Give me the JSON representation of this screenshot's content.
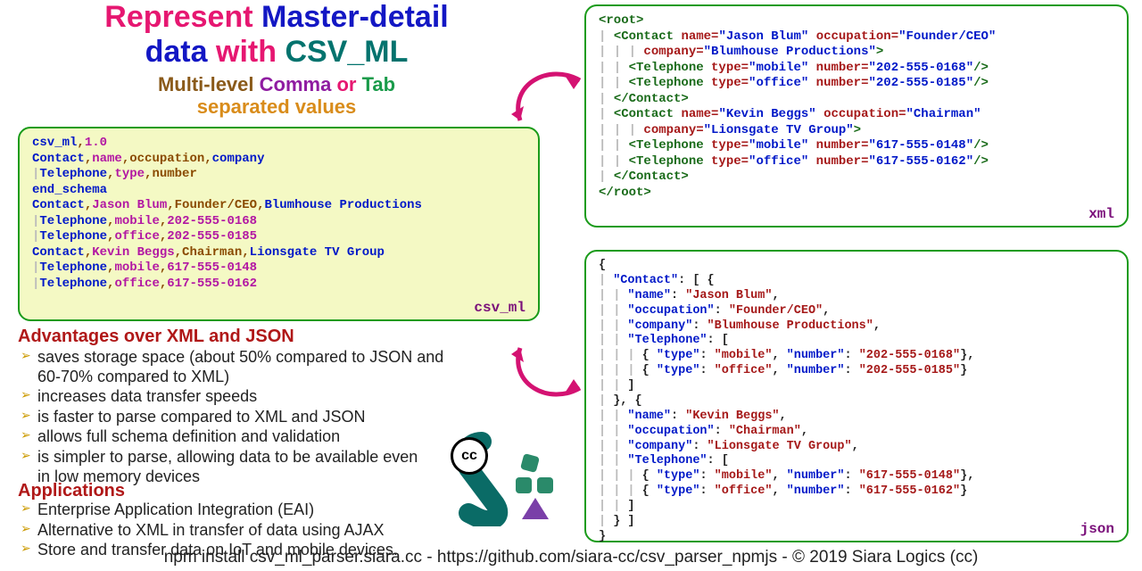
{
  "title": {
    "w1": "Represent",
    "w2": "Master-detail",
    "w3": "data",
    "w4": "with",
    "w5": "CSV_ML"
  },
  "subtitle": {
    "w1": "Multi-level",
    "w2": "Comma",
    "w3": "or",
    "w4": "Tab",
    "w5": "separated values"
  },
  "csvml": {
    "l1a": "csv_ml",
    "l1b": ",",
    "l1c": "1.0",
    "l2a": "Contact",
    "l2b": ",",
    "l2c": "name",
    "l2d": ",",
    "l2e": "occupation",
    "l2f": ",",
    "l2g": "company",
    "l3p": " |",
    "l3a": "Telephone",
    "l3b": ",",
    "l3c": "type",
    "l3d": ",",
    "l3e": "number",
    "l4": "end_schema",
    "l5a": "Contact",
    "l5b": ",",
    "l5c": "Jason Blum",
    "l5d": ",",
    "l5e": "Founder/CEO",
    "l5f": ",",
    "l5g": "Blumhouse Productions",
    "l6p": " |",
    "l6a": "Telephone",
    "l6b": ",",
    "l6c": "mobile",
    "l6d": ",",
    "l6e": "202-555-0168",
    "l7p": " |",
    "l7a": "Telephone",
    "l7b": ",",
    "l7c": "office",
    "l7d": ",",
    "l7e": "202-555-0185",
    "l8a": "Contact",
    "l8b": ",",
    "l8c": "Kevin Beggs",
    "l8d": ",",
    "l8e": "Chairman",
    "l8f": ",",
    "l8g": "Lionsgate TV Group",
    "l9p": " |",
    "l9a": "Telephone",
    "l9b": ",",
    "l9c": "mobile",
    "l9d": ",",
    "l9e": "617-555-0148",
    "l10p": " |",
    "l10a": "Telephone",
    "l10b": ",",
    "l10c": "office",
    "l10d": ",",
    "l10e": "617-555-0162",
    "label": "csv_ml"
  },
  "xml": {
    "label": "xml",
    "root_open": "<root>",
    "root_close": "</root>",
    "c1_open_a": "<Contact ",
    "c1_name_k": "name=",
    "c1_name_v": "\"Jason Blum\"",
    "sp": " ",
    "c1_occ_k": "occupation=",
    "c1_occ_v": "\"Founder/CEO\"",
    "c1_co_k": "company=",
    "c1_co_v": "\"Blumhouse Productions\"",
    "gt": ">",
    "t_open": "<Telephone ",
    "type_k": "type=",
    "num_k": "number=",
    "slashgt": "/>",
    "t1_type": "\"mobile\"",
    "t1_num": "\"202-555-0168\"",
    "t2_type": "\"office\"",
    "t2_num": "\"202-555-0185\"",
    "c_close": "</Contact>",
    "c2_name_v": "\"Kevin Beggs\"",
    "c2_occ_v": "\"Chairman\"",
    "c2_co_v": "\"Lionsgate TV Group\"",
    "t3_type": "\"mobile\"",
    "t3_num": "\"617-555-0148\"",
    "t4_type": "\"office\"",
    "t4_num": "\"617-555-0162\""
  },
  "json": {
    "label": "json",
    "brace_o": "{",
    "brace_c": "}",
    "brack_o": "[",
    "brack_c": "]",
    "contact_k": "\"Contact\"",
    "name_k": "\"name\"",
    "occ_k": "\"occupation\"",
    "co_k": "\"company\"",
    "tel_k": "\"Telephone\"",
    "type_k": "\"type\"",
    "num_k": "\"number\"",
    "c1_name": "\"Jason Blum\"",
    "c1_occ": "\"Founder/CEO\"",
    "c1_co": "\"Blumhouse Productions\"",
    "t1_type": "\"mobile\"",
    "t1_num": "\"202-555-0168\"",
    "t2_type": "\"office\"",
    "t2_num": "\"202-555-0185\"",
    "c2_name": "\"Kevin Beggs\"",
    "c2_occ": "\"Chairman\"",
    "c2_co": "\"Lionsgate TV Group\"",
    "t3_type": "\"mobile\"",
    "t3_num": "\"617-555-0148\"",
    "t4_type": "\"office\"",
    "t4_num": "\"617-555-0162\"",
    "colon": ": ",
    "comma": ",",
    "commaBrace": "}, {"
  },
  "advantages": {
    "heading": "Advantages over XML and JSON",
    "items": [
      "saves storage space (about 50% compared to JSON and 60-70% compared to XML)",
      "increases data transfer speeds",
      "is faster to parse compared to XML and JSON",
      "allows full schema definition and validation",
      "is simpler to parse, allowing data to be available even in low memory devices"
    ]
  },
  "apps": {
    "heading": "Applications",
    "items": [
      "Enterprise Application Integration (EAI)",
      "Alternative to XML in transfer of data using AJAX",
      "Store and transfer data on IoT and mobile devices."
    ]
  },
  "footer": "npm install csv_ml_parser.siara.cc - https://github.com/siara-cc/csv_parser_npmjs - © 2019 Siara Logics (cc)",
  "cc": "cc"
}
